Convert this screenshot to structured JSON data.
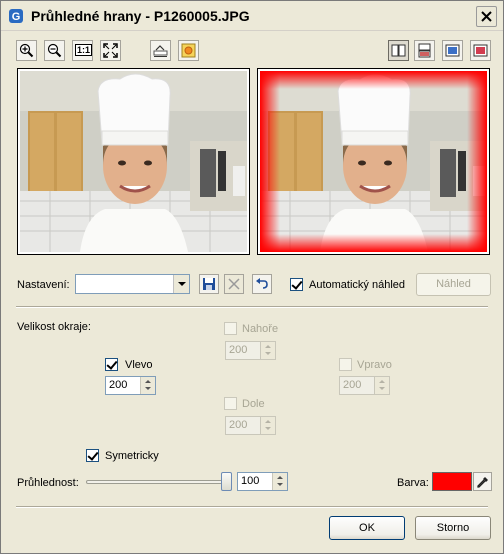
{
  "window": {
    "title": "Průhledné hrany - P1260005.JPG"
  },
  "toolbar": {
    "zoom_in_icon": "zoom-in-icon",
    "zoom_out_icon": "zoom-out-icon",
    "actual_size_label": "1:1",
    "fit_icon": "fit-to-window-icon",
    "view_icons": [
      "side-by-side-icon",
      "top-bottom-icon",
      "original-only-icon",
      "result-only-icon"
    ]
  },
  "settings": {
    "label": "Nastavení:",
    "value": "",
    "auto_preview_label": "Automatický náhled",
    "auto_preview_checked": true,
    "preview_button": "Náhled"
  },
  "border": {
    "heading": "Velikost okraje:",
    "top": {
      "label": "Nahoře",
      "value": "200",
      "checked": false,
      "enabled": false
    },
    "left": {
      "label": "Vlevo",
      "value": "200",
      "checked": true,
      "enabled": true
    },
    "right": {
      "label": "Vpravo",
      "value": "200",
      "checked": false,
      "enabled": false
    },
    "bottom": {
      "label": "Dole",
      "value": "200",
      "checked": false,
      "enabled": false
    },
    "symmetric_label": "Symetricky",
    "symmetric_checked": true
  },
  "transparency": {
    "label": "Průhlednost:",
    "value": "100",
    "slider_fraction": 1.0
  },
  "color": {
    "label": "Barva:",
    "swatch": "#ff0000"
  },
  "buttons": {
    "ok": "OK",
    "cancel": "Storno"
  }
}
